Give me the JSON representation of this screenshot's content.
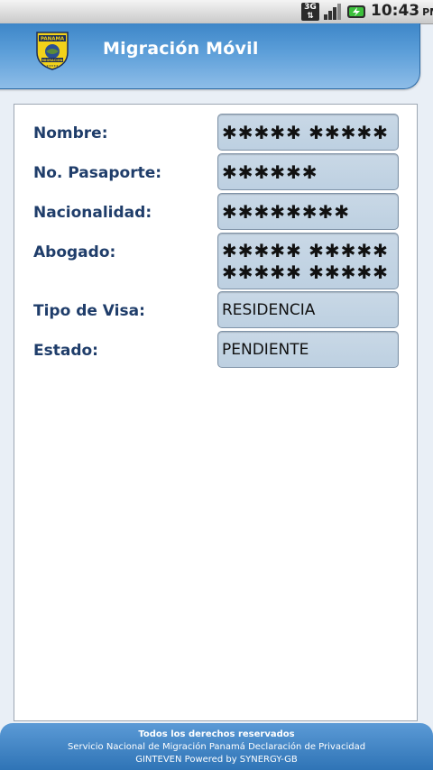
{
  "status_bar": {
    "network": "3G",
    "time": "10:43",
    "ampm": "PM"
  },
  "header": {
    "title": "Migración Móvil",
    "logo_text": "PANAMA",
    "logo_subtext": "MIGRACION"
  },
  "form": {
    "nombre_label": "Nombre:",
    "nombre_value": "✱✱✱✱✱ ✱✱✱✱✱",
    "pasaporte_label": "No. Pasaporte:",
    "pasaporte_value": "✱✱✱✱✱✱",
    "nacionalidad_label": "Nacionalidad:",
    "nacionalidad_value": "✱✱✱✱✱✱✱✱",
    "abogado_label": "Abogado:",
    "abogado_value_line1": "✱✱✱✱✱ ✱✱✱✱✱",
    "abogado_value_line2": "✱✱✱✱✱ ✱✱✱✱✱",
    "visa_label": "Tipo de Visa:",
    "visa_value": "RESIDENCIA",
    "estado_label": "Estado:",
    "estado_value": "PENDIENTE"
  },
  "footer": {
    "line1": "Todos los derechos reservados",
    "line2": "Servicio Nacional de Migración Panamá Declaración de Privacidad",
    "line3": "GINTEVEN Powered by SYNERGY-GB"
  },
  "colors": {
    "header_blue": "#4a90d0",
    "label_navy": "#1f3d6a",
    "field_bg": "#c4d5e5"
  }
}
